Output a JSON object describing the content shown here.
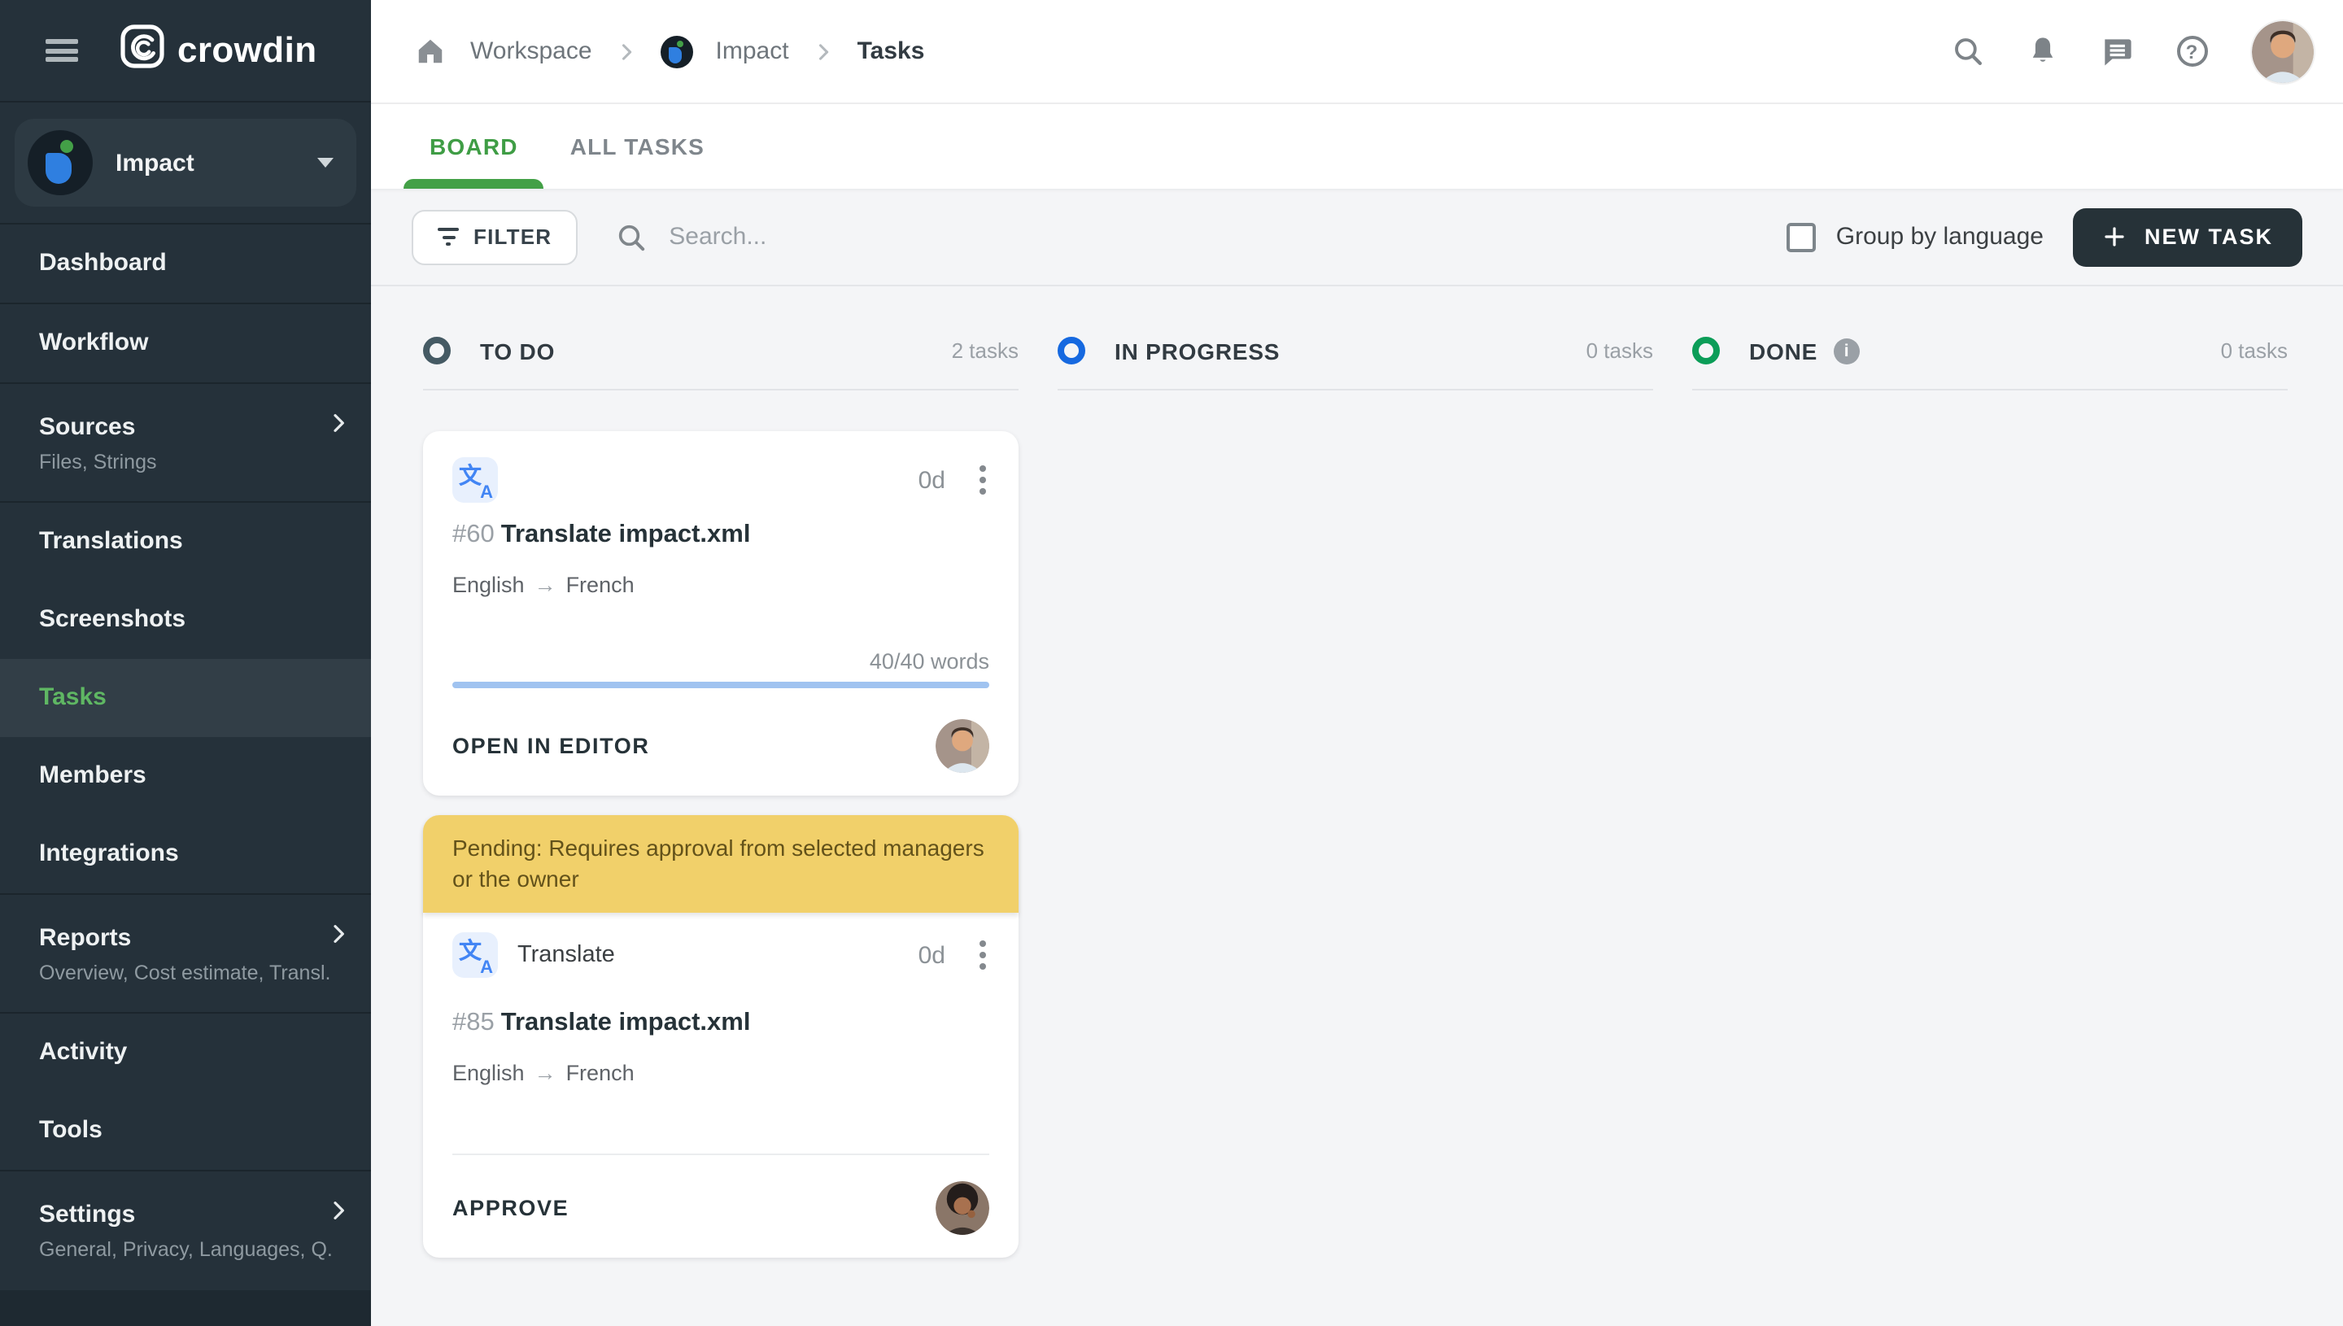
{
  "app": {
    "name": "crowdin"
  },
  "sidebar": {
    "project": {
      "name": "Impact"
    },
    "items": [
      {
        "label": "Dashboard"
      },
      {
        "label": "Workflow"
      },
      {
        "label": "Sources",
        "sub": "Files, Strings"
      },
      {
        "label": "Translations"
      },
      {
        "label": "Screenshots"
      },
      {
        "label": "Tasks"
      },
      {
        "label": "Members"
      },
      {
        "label": "Integrations"
      },
      {
        "label": "Reports",
        "sub": "Overview, Cost estimate, Transl..."
      },
      {
        "label": "Activity"
      },
      {
        "label": "Tools"
      },
      {
        "label": "Settings",
        "sub": "General, Privacy, Languages, Q..."
      }
    ]
  },
  "header": {
    "breadcrumb": [
      "Workspace",
      "Impact",
      "Tasks"
    ]
  },
  "tabs": [
    {
      "label": "BOARD"
    },
    {
      "label": "ALL TASKS"
    }
  ],
  "toolbar": {
    "filter_label": "FILTER",
    "search_placeholder": "Search...",
    "group_by_label": "Group by language",
    "new_task_label": "NEW TASK"
  },
  "board": {
    "columns": [
      {
        "title": "TO DO",
        "count": "2 tasks",
        "color": "#455a64"
      },
      {
        "title": "IN PROGRESS",
        "count": "0 tasks",
        "color": "#1669e0"
      },
      {
        "title": "DONE",
        "count": "0 tasks",
        "color": "#0b9d58",
        "info": "i"
      }
    ],
    "cards": [
      {
        "id": "#60",
        "title": "Translate impact.xml",
        "due": "0d",
        "lang_from": "English",
        "arrow": "→",
        "lang_to": "French",
        "progress": {
          "label": "40/40 words",
          "percent": "100%",
          "color": "#a0c3f0"
        },
        "action": "OPEN IN EDITOR"
      },
      {
        "banner": "Pending: Requires approval from selected managers or the owner",
        "banner_bg": "#f1d06a",
        "banner_text_color": "#63521a",
        "type_label": "Translate",
        "id": "#85",
        "title": "Translate impact.xml",
        "due": "0d",
        "lang_from": "English",
        "arrow": "→",
        "lang_to": "French",
        "action": "APPROVE"
      }
    ]
  }
}
